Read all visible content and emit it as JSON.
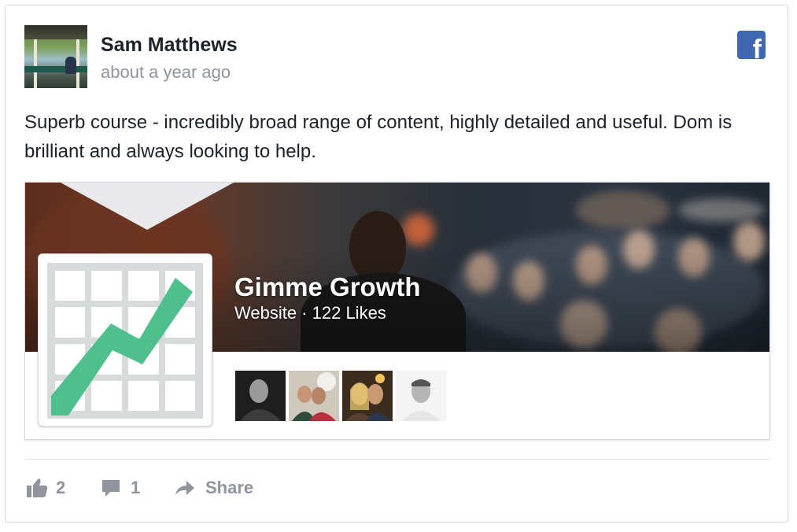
{
  "post": {
    "author": "Sam Matthews",
    "timestamp": "about a year ago",
    "text": "Superb course - incredibly broad range of content, highly detailed and useful. Dom is brilliant and always looking to help.",
    "platform_icon": "facebook-icon"
  },
  "page_card": {
    "name": "Gimme Growth",
    "meta": "Website · 122 Likes",
    "logo_icon": "growth-chart-logo",
    "logo_colors": {
      "grid": "#d8dbdb",
      "arrow": "#4fc08d"
    },
    "friend_avatars": [
      "friend-avatar-1",
      "friend-avatar-2",
      "friend-avatar-3",
      "friend-avatar-4"
    ]
  },
  "actions": {
    "likes": "2",
    "comments": "1",
    "share_label": "Share"
  },
  "colors": {
    "facebook_blue": "#4267b2",
    "text_primary": "#1d2129",
    "text_secondary": "#90949c",
    "border": "#d3d6db"
  }
}
